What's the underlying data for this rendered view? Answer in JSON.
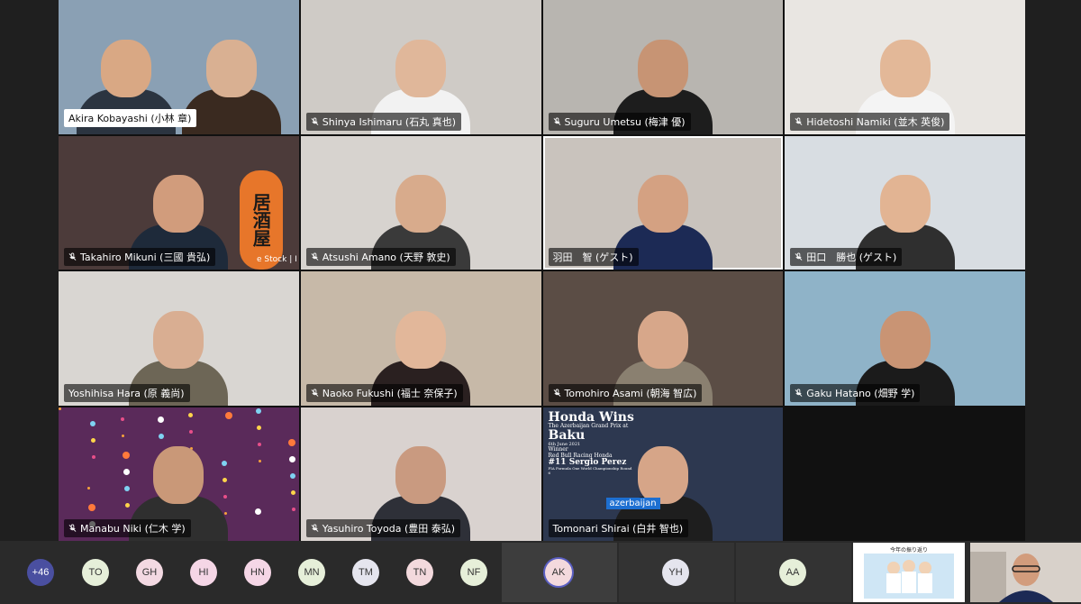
{
  "tiles": [
    {
      "name": "Akira Kobayashi (小林 章)",
      "style": "light",
      "bg": "#8aa0b4",
      "skin": "#d9a884",
      "shirt": "#2b3440",
      "mic": false
    },
    {
      "name": "Shinya Ishimaru (石丸 真也)",
      "style": "dark",
      "bg": "#cfcbc6",
      "skin": "#e0b79a",
      "shirt": "#f2f2f2",
      "mic": true
    },
    {
      "name": "Suguru Umetsu (梅津 優)",
      "style": "dark",
      "bg": "#b8b5b0",
      "skin": "#c79474",
      "shirt": "#1d1d1d",
      "mic": true
    },
    {
      "name": "Hidetoshi Namiki (並木 英俊)",
      "style": "dark",
      "bg": "#e9e6e2",
      "skin": "#e3b898",
      "shirt": "#f4f4f4",
      "mic": true
    },
    {
      "name": "Takahiro Mikuni (三國 貴弘)",
      "style": "dark",
      "bg": "#4c3b3a",
      "skin": "#d19c7c",
      "shirt": "#1e2a3a",
      "mic": true
    },
    {
      "name": "Atsushi Amano (天野 敦史)",
      "style": "dark",
      "bg": "#d7d3cf",
      "skin": "#d8ab8c",
      "shirt": "#3a3a3a",
      "mic": true
    },
    {
      "name": "羽田　智 (ゲスト)",
      "style": "dark",
      "bg": "#c9c3bd",
      "skin": "#d4a182",
      "shirt": "#1c2a55",
      "mic": false
    },
    {
      "name": "田口　勝也 (ゲスト)",
      "style": "dark",
      "bg": "#d8dde2",
      "skin": "#e2b493",
      "shirt": "#2f2f2f",
      "mic": true
    },
    {
      "name": "Yoshihisa Hara (原 義尚)",
      "style": "dark",
      "bg": "#d9d6d2",
      "skin": "#d9ae92",
      "shirt": "#6d6656",
      "mic": false
    },
    {
      "name": "Naoko Fukushi (福士 奈保子)",
      "style": "dark",
      "bg": "#c7b9a8",
      "skin": "#e2b79a",
      "shirt": "#2a2020",
      "mic": true
    },
    {
      "name": "Tomohiro Asami (朝海 智広)",
      "style": "dark",
      "bg": "#5b4d45",
      "skin": "#d7a78a",
      "shirt": "#8a8070",
      "mic": true
    },
    {
      "name": "Gaku Hatano (畑野 学)",
      "style": "dark",
      "bg": "#8fb3c8",
      "skin": "#c99474",
      "shirt": "#1b1b1b",
      "mic": true
    },
    {
      "name": "Manabu Niki (仁木 学)",
      "style": "dark",
      "bg": "#5a2a5a",
      "skin": "#c99878",
      "shirt": "#2f2f2f",
      "mic": true
    },
    {
      "name": "Yasuhiro Toyoda (豊田 泰弘)",
      "style": "dark",
      "bg": "#d9d2cf",
      "skin": "#c99a80",
      "shirt": "#2e3038",
      "mic": true
    },
    {
      "name": "Tomonari Shirai (白井 智也)",
      "style": "dark",
      "bg": "#2d3850",
      "skin": "#d6a588",
      "shirt": "#1e1e1e",
      "mic": false
    }
  ],
  "overlay_text": {
    "lantern": "居酒屋",
    "partial_name": "e Stock | I",
    "honda_title": "Honda Wins",
    "honda_sub": "The Azerbaijan Grand Prix at",
    "honda_city": "Baku",
    "honda_date": "6th June 2021",
    "honda_winner": "Winner",
    "honda_team": "Red Bull Racing Honda",
    "honda_driver": "#11 Sergio Perez",
    "honda_fia": "FIA Formula One World Championship Round 6",
    "honda_banner": "azerbaijan"
  },
  "participants": {
    "overflow_count": "+46",
    "chips": [
      {
        "initials": "TO",
        "color": "#e6efd9"
      },
      {
        "initials": "GH",
        "color": "#f3d9e2"
      },
      {
        "initials": "HI",
        "color": "#f5d6e6"
      },
      {
        "initials": "HN",
        "color": "#f5d6e6"
      },
      {
        "initials": "MN",
        "color": "#e6efd9"
      },
      {
        "initials": "TM",
        "color": "#e5e5ee"
      },
      {
        "initials": "TN",
        "color": "#f3d9dd"
      },
      {
        "initials": "NF",
        "color": "#e6efd9"
      },
      {
        "initials": "AK",
        "color": "#f3d9dd"
      },
      {
        "initials": "YH",
        "color": "#e5e5ee"
      },
      {
        "initials": "AA",
        "color": "#e6efd9"
      }
    ],
    "shared_thumb_title": "今年の振り返り"
  }
}
